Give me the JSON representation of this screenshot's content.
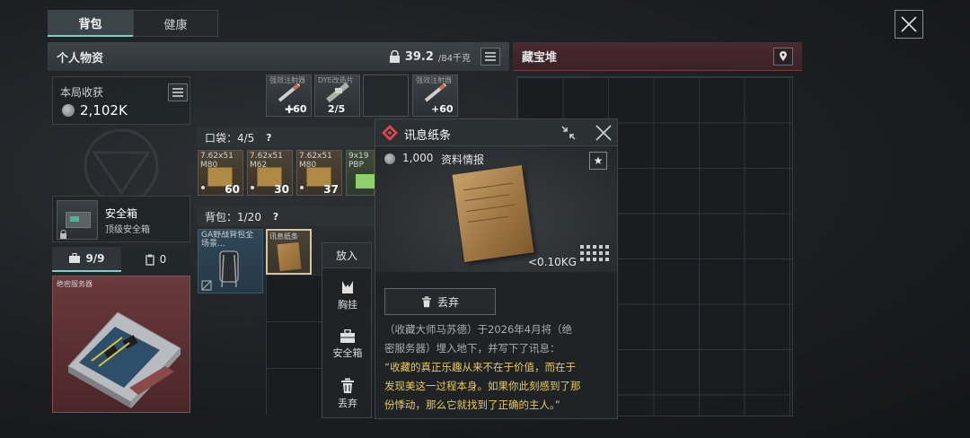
{
  "tabs": {
    "backpack": "背包",
    "health": "健康"
  },
  "personal": {
    "title": "个人物资",
    "weight_current": "39.2",
    "weight_max": "/84千克"
  },
  "stash": {
    "title": "藏宝堆"
  },
  "earnings": {
    "label": "本局收获",
    "value": "2,102K"
  },
  "top_items": [
    {
      "name": "强效注射器",
      "count": "+60"
    },
    {
      "name": "DYE改造片",
      "count": "2/5"
    },
    {
      "name": "",
      "count": ""
    },
    {
      "name": "强效注射器",
      "count": "+60"
    }
  ],
  "pocket": {
    "label": "口袋：4/5",
    "help": "?"
  },
  "pocket_items": [
    {
      "name": "7.62x51 M80",
      "count": "60"
    },
    {
      "name": "7.62x51 M62",
      "count": "30"
    },
    {
      "name": "7.62x51 M80",
      "count": "37"
    },
    {
      "name": "9x19 PBP",
      "count": ""
    }
  ],
  "safe": {
    "name": "安全箱",
    "type": "顶级安全箱"
  },
  "safe_tabs": {
    "tab1": "9/9",
    "tab2": "0"
  },
  "server": {
    "label": "绝密服务器"
  },
  "bag": {
    "label": "背包：1/20",
    "help": "?"
  },
  "bag_items": [
    {
      "name": "GA野战背包全场景..."
    },
    {
      "name": "讯息纸条"
    }
  ],
  "context_menu": {
    "header": "放入",
    "items": [
      "胸挂",
      "安全箱",
      "丢弃"
    ]
  },
  "detail": {
    "title": "讯息纸条",
    "price": "1,000",
    "category": "资料情报",
    "weight": "<0.10KG",
    "discard": "丢弃",
    "desc_line1": "（收藏大师马苏德）于2026年4月将（绝",
    "desc_line2": "密服务器）埋入地下，并写下了讯息：",
    "quote_line1": "“收藏的真正乐趣从来不在于价值，而在于",
    "quote_line2": "发现美这一过程本身。如果你此刻感到了那",
    "quote_line3": "份悸动，那么它就找到了正确的主人。”"
  },
  "colors": {
    "accent": "#7ad0c2",
    "quote": "#e7c85a",
    "stash": "#4a2a2f",
    "detail_icon": "#d8464a"
  }
}
